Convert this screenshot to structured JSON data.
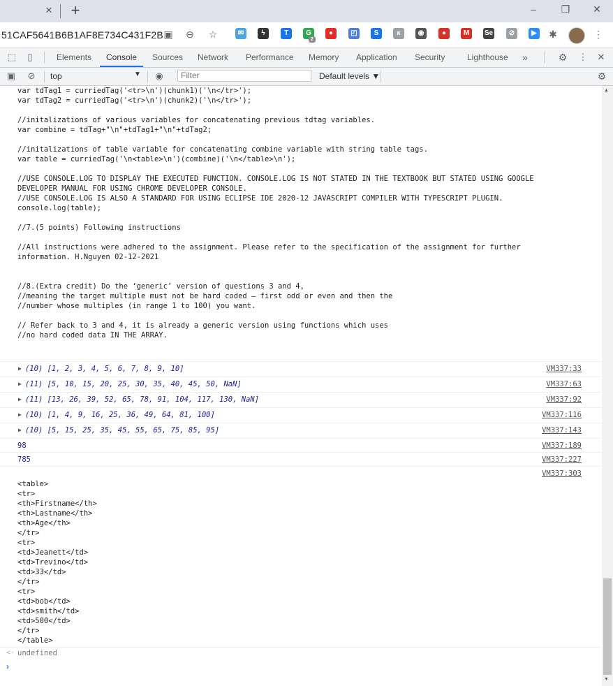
{
  "browser": {
    "tab_close": "×",
    "new_tab": "+",
    "window_buttons": [
      "–",
      "❐",
      "✕"
    ],
    "url": "51CAF5641B6B1AF8E734C431F2B",
    "icons": [
      "translate-icon",
      "zoom-icon",
      "star-icon"
    ],
    "extensions": [
      {
        "name": "mail-extension-icon",
        "label": "✉",
        "color": "#4fa3e0"
      },
      {
        "name": "bolt-extension-icon",
        "label": "ϟ",
        "color": "#333333"
      },
      {
        "name": "t-extension-icon",
        "label": "T",
        "color": "#1a73e8"
      },
      {
        "name": "g-extension-icon",
        "label": "G",
        "color": "#34a853"
      },
      {
        "name": "stop-extension-icon",
        "label": "●",
        "color": "#e52d27"
      },
      {
        "name": "puzzle-blue-extension-icon",
        "label": "◰",
        "color": "#4f7fd8"
      },
      {
        "name": "s-extension-icon",
        "label": "S",
        "color": "#1a73e8"
      },
      {
        "name": "gray-extension-icon",
        "label": "ĸ",
        "color": "#9aa0a6"
      },
      {
        "name": "film-extension-icon",
        "label": "◉",
        "color": "#555555"
      },
      {
        "name": "balls-extension-icon",
        "label": "●",
        "color": "#d93025"
      },
      {
        "name": "gmail-extension-icon",
        "label": "M",
        "color": "#d93025"
      },
      {
        "name": "se-extension-icon",
        "label": "Se",
        "color": "#444444"
      },
      {
        "name": "link-extension-icon",
        "label": "⊘",
        "color": "#9aa0a6"
      },
      {
        "name": "zoom-extension-icon",
        "label": "▶",
        "color": "#2d8cff"
      }
    ],
    "badge": "2"
  },
  "devtools": {
    "tabs": [
      "Elements",
      "Console",
      "Sources",
      "Network",
      "Performance",
      "Memory",
      "Application",
      "Security",
      "Lighthouse"
    ],
    "active_tab": "Console",
    "more": "»",
    "context": "top",
    "filter_placeholder": "Filter",
    "levels": "Default levels ▼"
  },
  "console": {
    "code": "var tdTag1 = curriedTag('<tr>\\n')(chunk1)('\\n</tr>');\nvar tdTag2 = curriedTag('<tr>\\n')(chunk2)('\\n</tr>');\n\n//initalizations of various variables for concatenating previous tdtag variables.\nvar combine = tdTag+\"\\n\"+tdTag1+\"\\n\"+tdTag2;\n\n//initalizations of table variable for concatenating combine variable with string table tags.\nvar table = curriedTag('\\n<table>\\n')(combine)('\\n</table>\\n');\n\n//USE CONSOLE.LOG TO DISPLAY THE EXECUTED FUNCTION. CONSOLE.LOG IS NOT STATED IN THE TEXTBOOK BUT STATED USING GOOGLE\nDEVELOPER MANUAL FOR USING CHROME DEVELOPER CONSOLE.\n//USE CONSOLE.LOG IS ALSO A STANDARD FOR USING ECLIPSE IDE 2020-12 JAVASCRIPT COMPILER WITH TYPESCRIPT PLUGIN.\nconsole.log(table);\n\n//7.(5 points) Following instructions\n\n//All instructions were adhered to the assignment. Please refer to the specification of the assignment for further\ninformation. H.Nguyen 02-12-2021\n\n\n//8.(Extra credit) Do the ‘generic’ version of questions 3 and 4,\n//meaning the target multiple must not be hard coded – first odd or even and then the\n//number whose multiples (in range 1 to 100) you want.\n\n// Refer back to 3 and 4, it is already a generic version using functions which uses\n//no hard coded data IN THE ARRAY.",
    "arrays": [
      {
        "text": "(10) [1, 2, 3, 4, 5, 6, 7, 8, 9, 10]",
        "src": "VM337:33"
      },
      {
        "text": "(11) [5, 10, 15, 20, 25, 30, 35, 40, 45, 50, NaN]",
        "src": "VM337:63"
      },
      {
        "text": "(11) [13, 26, 39, 52, 65, 78, 91, 104, 117, 130, NaN]",
        "src": "VM337:92"
      },
      {
        "text": "(10) [1, 4, 9, 16, 25, 36, 49, 64, 81, 100]",
        "src": "VM337:116"
      },
      {
        "text": "(10) [5, 15, 25, 35, 45, 55, 65, 75, 85, 95]",
        "src": "VM337:143"
      }
    ],
    "numbers": [
      {
        "text": "98",
        "src": "VM337:189"
      },
      {
        "text": "785",
        "src": "VM337:227"
      }
    ],
    "table_src": "VM337:303",
    "table_output": "<table>\n<tr>\n<th>Firstname</th>\n<th>Lastname</th>\n<th>Age</th>\n</tr>\n<tr>\n<td>Jeanett</td>\n<td>Trevino</td>\n<td>33</td>\n</tr>\n<tr>\n<td>bob</td>\n<td>smith</td>\n<td>500</td>\n</tr>\n</table>",
    "return_value": "undefined",
    "prompt": "›"
  }
}
